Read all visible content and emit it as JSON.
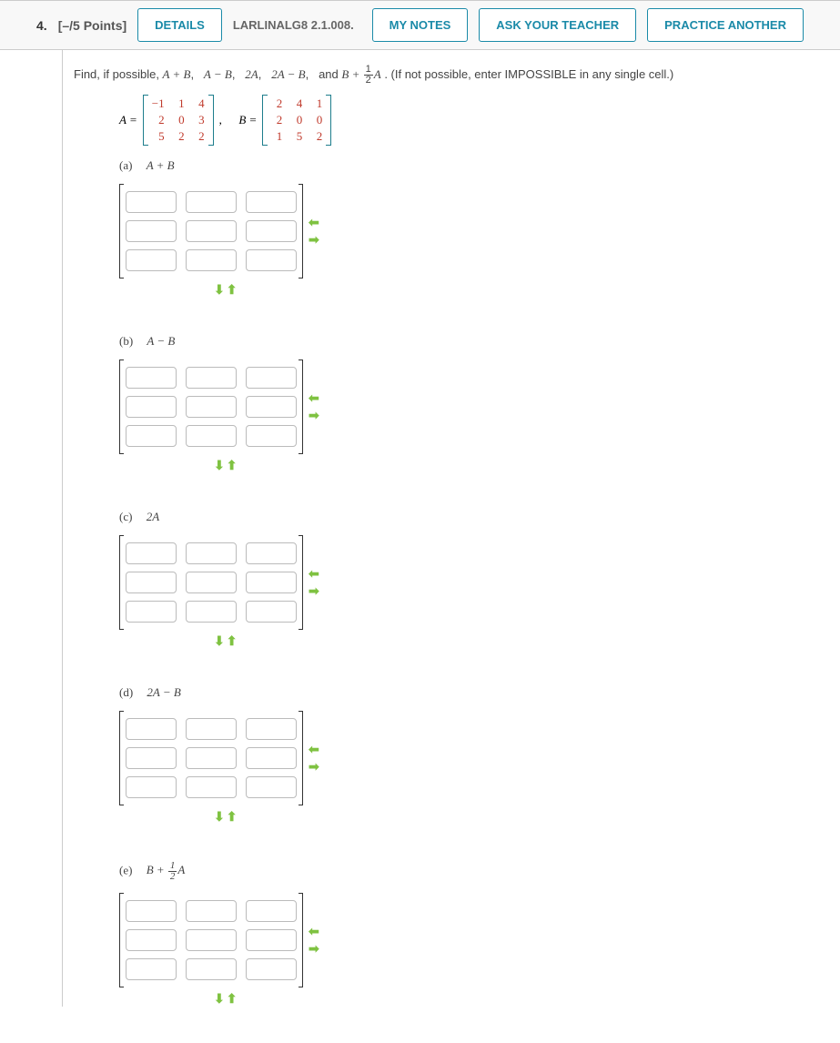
{
  "header": {
    "qnum": "4.",
    "points": "[–/5 Points]",
    "details": "DETAILS",
    "assignment": "LARLINALG8 2.1.008.",
    "notes": "MY NOTES",
    "ask": "ASK YOUR TEACHER",
    "practice": "PRACTICE ANOTHER"
  },
  "question": {
    "lead": "Find, if possible,  ",
    "e1": "A + B",
    "e2": "A − B",
    "e3": "2A",
    "e4": "2A − B",
    "e5pre": "B + ",
    "e5post": "A",
    "frac_num": "1",
    "frac_den": "2",
    "and": "and  ",
    "note": ".  (If not possible, enter IMPOSSIBLE in any single cell.)"
  },
  "matA": {
    "label": "A =",
    "r0c0": "−1",
    "r0c1": "1",
    "r0c2": "4",
    "r1c0": "2",
    "r1c1": "0",
    "r1c2": "3",
    "r2c0": "5",
    "r2c1": "2",
    "r2c2": "2"
  },
  "matB": {
    "label": "B =",
    "comma": ",",
    "r0c0": "2",
    "r0c1": "4",
    "r0c2": "1",
    "r1c0": "2",
    "r1c1": "0",
    "r1c2": "0",
    "r2c0": "1",
    "r2c1": "5",
    "r2c2": "2"
  },
  "parts": {
    "a": {
      "label": "(a)",
      "expr": "A + B"
    },
    "b": {
      "label": "(b)",
      "expr": "A − B"
    },
    "c": {
      "label": "(c)",
      "expr": "2A"
    },
    "d": {
      "label": "(d)",
      "expr": "2A − B"
    },
    "e": {
      "label": "(e)",
      "expr_pre": "B + ",
      "expr_post": "A",
      "frac_num": "1",
      "frac_den": "2"
    }
  },
  "arrows": {
    "left": "⬅",
    "right": "➡",
    "down": "⬇",
    "up": "⬆"
  }
}
